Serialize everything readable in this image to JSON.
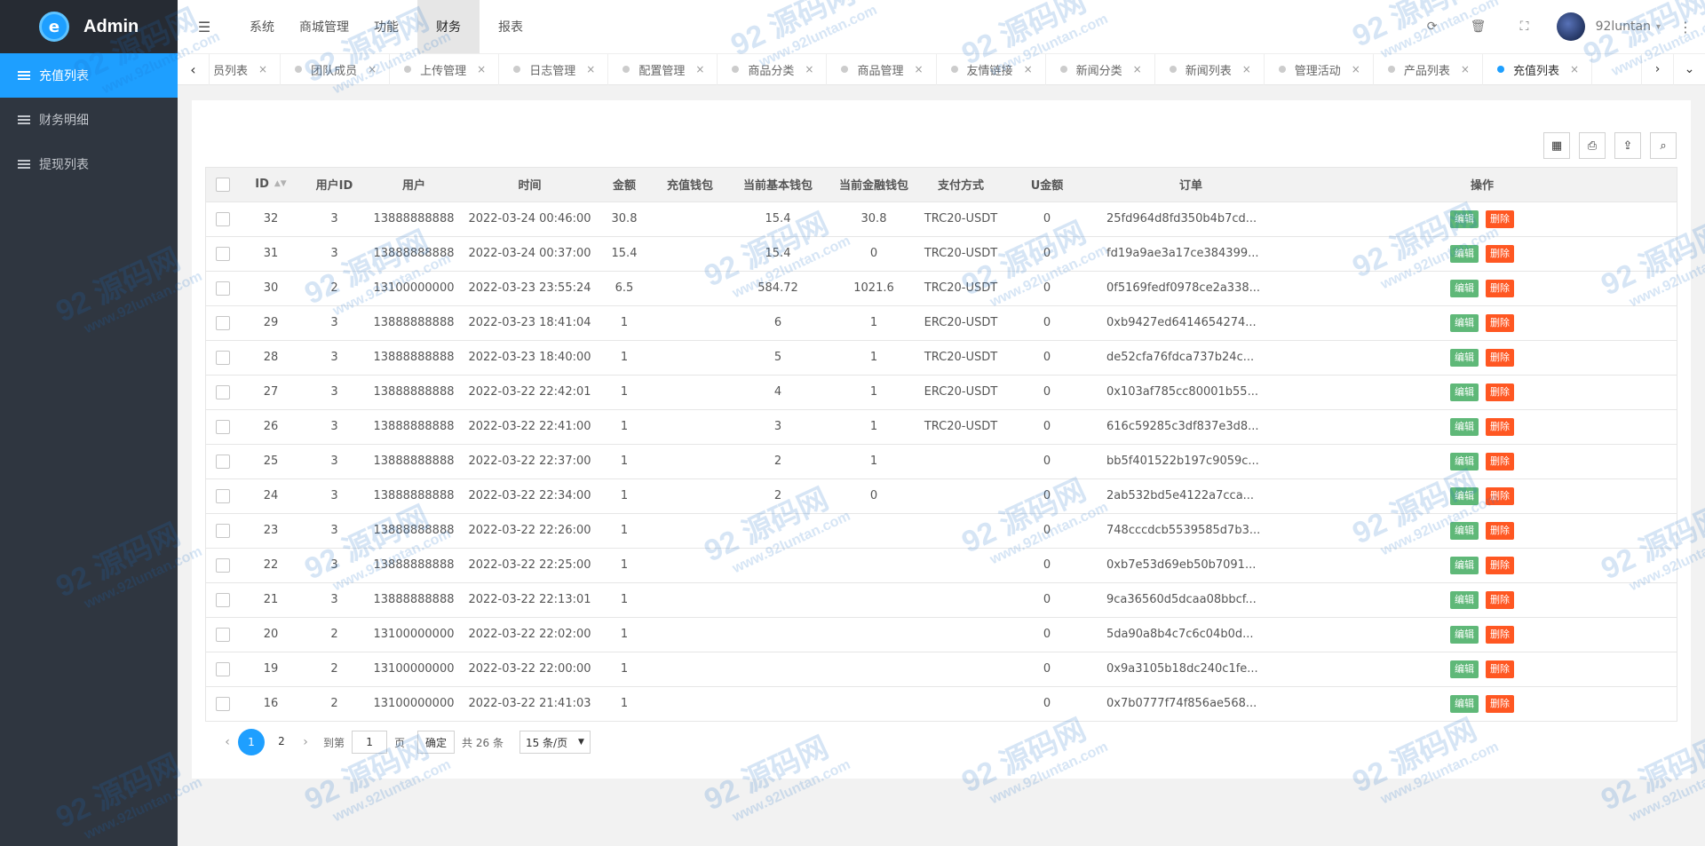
{
  "brand": {
    "name": "Admin",
    "logo_letter": "e"
  },
  "sidebar": {
    "items": [
      {
        "label": "充值列表",
        "active": true
      },
      {
        "label": "财务明细",
        "active": false
      },
      {
        "label": "提现列表",
        "active": false
      }
    ]
  },
  "header": {
    "toggle_icon": "☰",
    "nav": [
      {
        "label": "系统",
        "active": false
      },
      {
        "label": "商城管理",
        "active": false
      },
      {
        "label": "功能",
        "active": false
      },
      {
        "label": "财务",
        "active": true
      },
      {
        "label": "报表",
        "active": false
      }
    ],
    "icons": {
      "refresh": "⟳",
      "clear": "🗑",
      "fullscreen": "⛶"
    },
    "user": "92luntan",
    "caret": "▾",
    "more": "⋮"
  },
  "tabs": {
    "prev": "‹",
    "next": "›",
    "dropdown": "⌄",
    "items": [
      {
        "label": "员列表",
        "active": false
      },
      {
        "label": "团队成员",
        "active": false
      },
      {
        "label": "上传管理",
        "active": false
      },
      {
        "label": "日志管理",
        "active": false
      },
      {
        "label": "配置管理",
        "active": false
      },
      {
        "label": "商品分类",
        "active": false
      },
      {
        "label": "商品管理",
        "active": false
      },
      {
        "label": "友情链接",
        "active": false
      },
      {
        "label": "新闻分类",
        "active": false
      },
      {
        "label": "新闻列表",
        "active": false
      },
      {
        "label": "管理活动",
        "active": false
      },
      {
        "label": "产品列表",
        "active": false
      },
      {
        "label": "充值列表",
        "active": true
      }
    ],
    "close": "×"
  },
  "toolbar": {
    "icons": [
      "▦",
      "⎙",
      "⇪",
      "⌕"
    ]
  },
  "table": {
    "headers": [
      "",
      "ID",
      "用户ID",
      "用户",
      "时间",
      "金额",
      "充值钱包",
      "当前基本钱包",
      "当前金融钱包",
      "支付方式",
      "U金额",
      "订单",
      "操作"
    ],
    "sort_icon": "▲▼",
    "edit_label": "编辑",
    "delete_label": "删除",
    "rows": [
      [
        "32",
        "3",
        "13888888888",
        "2022-03-24 00:46:00",
        "30.8",
        "",
        "15.4",
        "30.8",
        "TRC20-USDT",
        "0",
        "25fd964d8fd350b4b7cd..."
      ],
      [
        "31",
        "3",
        "13888888888",
        "2022-03-24 00:37:00",
        "15.4",
        "",
        "15.4",
        "0",
        "TRC20-USDT",
        "0",
        "fd19a9ae3a17ce384399..."
      ],
      [
        "30",
        "2",
        "13100000000",
        "2022-03-23 23:55:24",
        "6.5",
        "",
        "584.72",
        "1021.6",
        "TRC20-USDT",
        "0",
        "0f5169fedf0978ce2a338..."
      ],
      [
        "29",
        "3",
        "13888888888",
        "2022-03-23 18:41:04",
        "1",
        "",
        "6",
        "1",
        "ERC20-USDT",
        "0",
        "0xb9427ed6414654274..."
      ],
      [
        "28",
        "3",
        "13888888888",
        "2022-03-23 18:40:00",
        "1",
        "",
        "5",
        "1",
        "TRC20-USDT",
        "0",
        "de52cfa76fdca737b24c..."
      ],
      [
        "27",
        "3",
        "13888888888",
        "2022-03-22 22:42:01",
        "1",
        "",
        "4",
        "1",
        "ERC20-USDT",
        "0",
        "0x103af785cc80001b55..."
      ],
      [
        "26",
        "3",
        "13888888888",
        "2022-03-22 22:41:00",
        "1",
        "",
        "3",
        "1",
        "TRC20-USDT",
        "0",
        "616c59285c3df837e3d8..."
      ],
      [
        "25",
        "3",
        "13888888888",
        "2022-03-22 22:37:00",
        "1",
        "",
        "2",
        "1",
        "",
        "0",
        "bb5f401522b197c9059c..."
      ],
      [
        "24",
        "3",
        "13888888888",
        "2022-03-22 22:34:00",
        "1",
        "",
        "2",
        "0",
        "",
        "0",
        "2ab532bd5e4122a7cca..."
      ],
      [
        "23",
        "3",
        "13888888888",
        "2022-03-22 22:26:00",
        "1",
        "",
        "",
        "",
        "",
        "0",
        "748cccdcb5539585d7b3..."
      ],
      [
        "22",
        "3",
        "13888888888",
        "2022-03-22 22:25:00",
        "1",
        "",
        "",
        "",
        "",
        "0",
        "0xb7e53d69eb50b7091..."
      ],
      [
        "21",
        "3",
        "13888888888",
        "2022-03-22 22:13:01",
        "1",
        "",
        "",
        "",
        "",
        "0",
        "9ca36560d5dcaa08bbcf..."
      ],
      [
        "20",
        "2",
        "13100000000",
        "2022-03-22 22:02:00",
        "1",
        "",
        "",
        "",
        "",
        "0",
        "5da90a8b4c7c6c04b0d..."
      ],
      [
        "19",
        "2",
        "13100000000",
        "2022-03-22 22:00:00",
        "1",
        "",
        "",
        "",
        "",
        "0",
        "0x9a3105b18dc240c1fe..."
      ],
      [
        "16",
        "2",
        "13100000000",
        "2022-03-22 21:41:03",
        "1",
        "",
        "",
        "",
        "",
        "0",
        "0x7b0777f74f856ae568..."
      ]
    ]
  },
  "pager": {
    "prev": "‹",
    "next": "›",
    "pages": [
      "1",
      "2"
    ],
    "current": "1",
    "goto_label": "到第",
    "goto_value": "1",
    "page_unit": "页",
    "confirm": "确定",
    "total": "共 26 条",
    "per_page": "15 条/页",
    "select_caret": "▼"
  },
  "watermark": {
    "big": "92 源码网",
    "small": "www.92luntan.com"
  },
  "colors": {
    "accent": "#1e9fff",
    "sidebar": "#2f3640",
    "edit": "#5fb878",
    "delete": "#ff5722"
  }
}
